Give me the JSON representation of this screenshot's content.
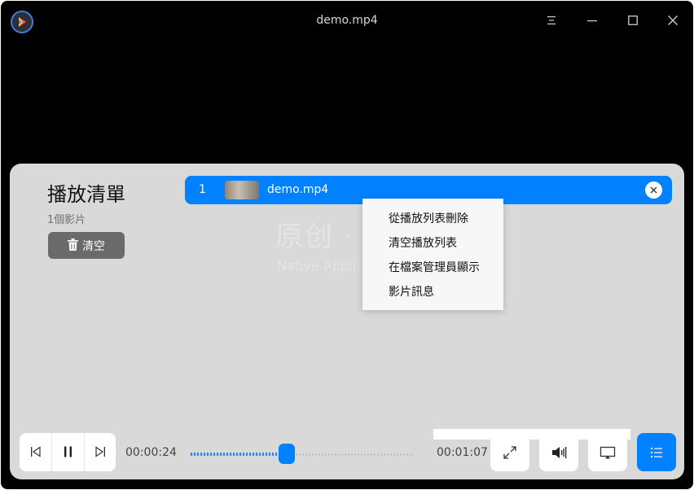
{
  "window": {
    "title": "demo.mp4"
  },
  "playlist": {
    "title": "播放清單",
    "count": "1個影片",
    "clear_label": "清空",
    "watermark_main": "原创 · ",
    "watermark_sub": "Native Appli",
    "items": [
      {
        "index": "1",
        "name": "demo.mp4"
      }
    ]
  },
  "context_menu": {
    "items": [
      "從播放列表刪除",
      "清空播放列表",
      "在檔案管理員顯示",
      "影片訊息"
    ]
  },
  "player": {
    "current_time": "00:00:24",
    "total_time": "00:01:07",
    "progress": 0.43
  },
  "colors": {
    "accent": "#0081ff",
    "panel": "#d9d9d9",
    "video_bg": "#000000"
  }
}
